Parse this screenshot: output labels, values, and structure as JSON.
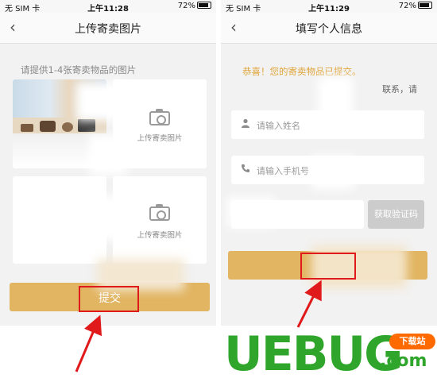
{
  "left_screen": {
    "status": {
      "carrier": "无 SIM 卡",
      "time": "上午11:28",
      "battery": "72%"
    },
    "nav": {
      "back_icon": "‹",
      "title": "上传寄卖图片"
    },
    "hint": "请提供1-4张寄卖物品的图片",
    "upload_tiles": [
      {
        "label": "上传寄卖图片"
      },
      {
        "label": "上传寄卖图片"
      }
    ],
    "submit_label": "提交"
  },
  "right_screen": {
    "status": {
      "carrier": "无 SIM 卡",
      "time": "上午11:29",
      "battery": "72%"
    },
    "nav": {
      "back_icon": "‹",
      "title": "填写个人信息"
    },
    "congrats": "恭喜！您的寄卖物品已提交。",
    "congrats_fragment": "联系，请",
    "name_placeholder": "请输入姓名",
    "phone_placeholder": "请输入手机号",
    "code_button": "获取验证码"
  },
  "watermark": {
    "brand": "UEBUG",
    "domain": ".com",
    "badge": "下载站"
  },
  "colors": {
    "accent": "#e2b562",
    "highlight": "#e0191b",
    "brand": "#2fa62b",
    "badge": "#ff6a00"
  }
}
